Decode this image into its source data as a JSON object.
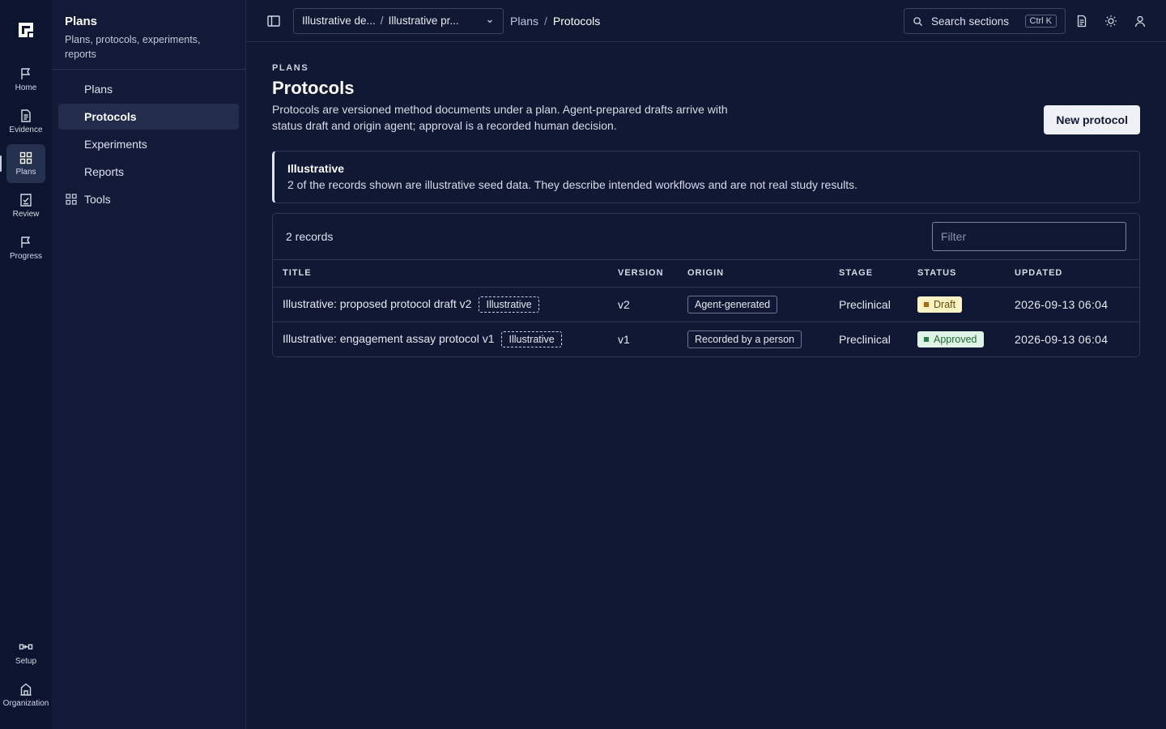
{
  "rail": {
    "items": [
      {
        "label": "Home",
        "icon": "flag-icon"
      },
      {
        "label": "Evidence",
        "icon": "document-icon"
      },
      {
        "label": "Plans",
        "icon": "grid-icon"
      },
      {
        "label": "Review",
        "icon": "checklist-icon"
      },
      {
        "label": "Progress",
        "icon": "flag-icon"
      }
    ],
    "bottom": [
      {
        "label": "Setup",
        "icon": "connector-icon"
      },
      {
        "label": "Organization",
        "icon": "building-icon"
      }
    ]
  },
  "sidebar": {
    "title": "Plans",
    "subtitle": "Plans, protocols, experiments, reports",
    "items": [
      {
        "label": "Plans"
      },
      {
        "label": "Protocols"
      },
      {
        "label": "Experiments"
      },
      {
        "label": "Reports"
      },
      {
        "label": "Tools"
      }
    ]
  },
  "topbar": {
    "context_left": "Illustrative de...",
    "context_right": "Illustrative pr...",
    "breadcrumb": [
      "Plans",
      "Protocols"
    ],
    "search_label": "Search sections",
    "search_shortcut": "Ctrl K"
  },
  "main": {
    "eyebrow": "PLANS",
    "title": "Protocols",
    "description": "Protocols are versioned method documents under a plan. Agent-prepared drafts arrive with status draft and origin agent; approval is a recorded human decision.",
    "new_button": "New protocol",
    "notice": {
      "title": "Illustrative",
      "text": "2 of the records shown are illustrative seed data. They describe intended workflows and are not real study results."
    }
  },
  "table": {
    "record_count": "2 records",
    "filter_placeholder": "Filter",
    "columns": [
      "TITLE",
      "VERSION",
      "ORIGIN",
      "STAGE",
      "STATUS",
      "UPDATED"
    ],
    "rows": [
      {
        "title": "Illustrative: proposed protocol draft v2",
        "tag": "Illustrative",
        "version": "v2",
        "origin": "Agent-generated",
        "stage": "Preclinical",
        "status": "Draft",
        "updated": "2026-09-13 06:04"
      },
      {
        "title": "Illustrative: engagement assay protocol v1",
        "tag": "Illustrative",
        "version": "v1",
        "origin": "Recorded by a person",
        "stage": "Preclinical",
        "status": "Approved",
        "updated": "2026-09-13 06:04"
      }
    ]
  },
  "colors": {
    "background": "#101833",
    "draft_badge": "#fdf3c7",
    "approved_badge": "#dff3e6"
  }
}
